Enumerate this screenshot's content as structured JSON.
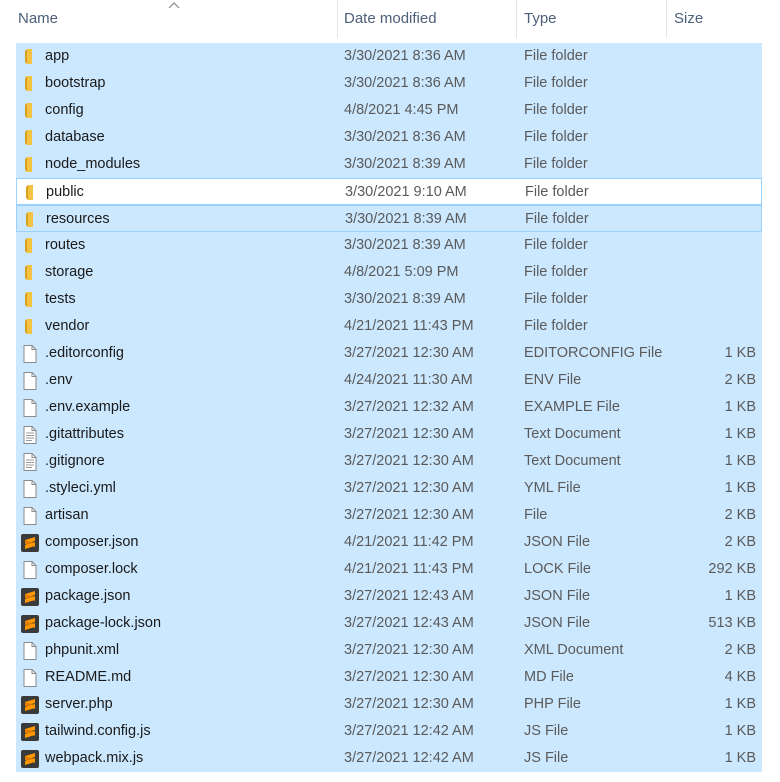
{
  "columns": {
    "name": "Name",
    "date": "Date modified",
    "type": "Type",
    "size": "Size"
  },
  "colors": {
    "selected": "#cce8ff",
    "focus_border": "#99d1ff",
    "folder": "#f5c342",
    "sublime": "#ff9800"
  },
  "files": [
    {
      "name": "app",
      "date": "3/30/2021 8:36 AM",
      "type": "File folder",
      "size": "",
      "icon": "folder-icon"
    },
    {
      "name": "bootstrap",
      "date": "3/30/2021 8:36 AM",
      "type": "File folder",
      "size": "",
      "icon": "folder-icon"
    },
    {
      "name": "config",
      "date": "4/8/2021 4:45 PM",
      "type": "File folder",
      "size": "",
      "icon": "folder-icon"
    },
    {
      "name": "database",
      "date": "3/30/2021 8:36 AM",
      "type": "File folder",
      "size": "",
      "icon": "folder-icon"
    },
    {
      "name": "node_modules",
      "date": "3/30/2021 8:39 AM",
      "type": "File folder",
      "size": "",
      "icon": "folder-icon"
    },
    {
      "name": "public",
      "date": "3/30/2021 9:10 AM",
      "type": "File folder",
      "size": "",
      "icon": "folder-icon"
    },
    {
      "name": "resources",
      "date": "3/30/2021 8:39 AM",
      "type": "File folder",
      "size": "",
      "icon": "folder-icon"
    },
    {
      "name": "routes",
      "date": "3/30/2021 8:39 AM",
      "type": "File folder",
      "size": "",
      "icon": "folder-icon"
    },
    {
      "name": "storage",
      "date": "4/8/2021 5:09 PM",
      "type": "File folder",
      "size": "",
      "icon": "folder-icon"
    },
    {
      "name": "tests",
      "date": "3/30/2021 8:39 AM",
      "type": "File folder",
      "size": "",
      "icon": "folder-icon"
    },
    {
      "name": "vendor",
      "date": "4/21/2021 11:43 PM",
      "type": "File folder",
      "size": "",
      "icon": "folder-icon"
    },
    {
      "name": ".editorconfig",
      "date": "3/27/2021 12:30 AM",
      "type": "EDITORCONFIG File",
      "size": "1 KB",
      "icon": "file-icon"
    },
    {
      "name": ".env",
      "date": "4/24/2021 11:30 AM",
      "type": "ENV File",
      "size": "2 KB",
      "icon": "file-icon"
    },
    {
      "name": ".env.example",
      "date": "3/27/2021 12:32 AM",
      "type": "EXAMPLE File",
      "size": "1 KB",
      "icon": "file-icon"
    },
    {
      "name": ".gitattributes",
      "date": "3/27/2021 12:30 AM",
      "type": "Text Document",
      "size": "1 KB",
      "icon": "text-file-icon"
    },
    {
      "name": ".gitignore",
      "date": "3/27/2021 12:30 AM",
      "type": "Text Document",
      "size": "1 KB",
      "icon": "text-file-icon"
    },
    {
      "name": ".styleci.yml",
      "date": "3/27/2021 12:30 AM",
      "type": "YML File",
      "size": "1 KB",
      "icon": "file-icon"
    },
    {
      "name": "artisan",
      "date": "3/27/2021 12:30 AM",
      "type": "File",
      "size": "2 KB",
      "icon": "file-icon"
    },
    {
      "name": "composer.json",
      "date": "4/21/2021 11:42 PM",
      "type": "JSON File",
      "size": "2 KB",
      "icon": "sublime-icon"
    },
    {
      "name": "composer.lock",
      "date": "4/21/2021 11:43 PM",
      "type": "LOCK File",
      "size": "292 KB",
      "icon": "file-icon"
    },
    {
      "name": "package.json",
      "date": "3/27/2021 12:43 AM",
      "type": "JSON File",
      "size": "1 KB",
      "icon": "sublime-icon"
    },
    {
      "name": "package-lock.json",
      "date": "3/27/2021 12:43 AM",
      "type": "JSON File",
      "size": "513 KB",
      "icon": "sublime-icon"
    },
    {
      "name": "phpunit.xml",
      "date": "3/27/2021 12:30 AM",
      "type": "XML Document",
      "size": "2 KB",
      "icon": "file-icon"
    },
    {
      "name": "README.md",
      "date": "3/27/2021 12:30 AM",
      "type": "MD File",
      "size": "4 KB",
      "icon": "file-icon"
    },
    {
      "name": "server.php",
      "date": "3/27/2021 12:30 AM",
      "type": "PHP File",
      "size": "1 KB",
      "icon": "sublime-icon"
    },
    {
      "name": "tailwind.config.js",
      "date": "3/27/2021 12:42 AM",
      "type": "JS File",
      "size": "1 KB",
      "icon": "sublime-icon"
    },
    {
      "name": "webpack.mix.js",
      "date": "3/27/2021 12:42 AM",
      "type": "JS File",
      "size": "1 KB",
      "icon": "sublime-icon"
    }
  ]
}
